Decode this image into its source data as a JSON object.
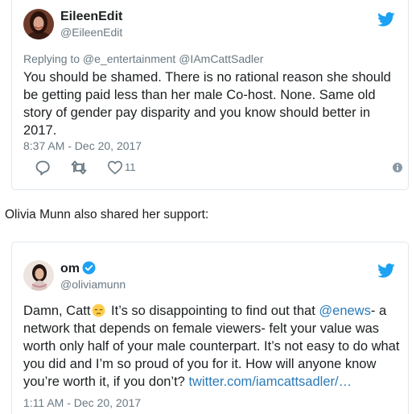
{
  "tweets": [
    {
      "display_name": "EileenEdit",
      "handle": "@EileenEdit",
      "reply_context": "Replying to @e_entertainment @IAmCattSadler",
      "body": "You should be shamed. There is no rational reason she should be getting paid less than her male Co-host. None. Same old story of gender pay disparity and you know should better in 2017.",
      "timestamp": "8:37 AM - Dec 20, 2017",
      "like_count": "11",
      "icons": [
        "twitter-bird-icon",
        "reply-icon",
        "retweet-icon",
        "heart-icon",
        "info-icon"
      ]
    },
    {
      "display_name": "om",
      "verified": true,
      "handle": "@oliviamunn",
      "body_before_emoji": "Damn, Catt",
      "body_after_emoji": " It’s so disappointing to find out that ",
      "mention": "@enews",
      "body_after_mention": "- a network that depends on female viewers- felt your value was worth only half of your male counterpart. It’s not easy to do what you did and I’m so proud of you for it. How will anyone know you’re worth it, if you don’t? ",
      "link": "twitter.com/iamcattsadler/…",
      "timestamp": "1:11 AM - Dec 20, 2017",
      "icons": [
        "twitter-bird-icon",
        "verified-badge-icon",
        "pensive-face-emoji"
      ]
    }
  ],
  "between_text": "Olivia Munn also shared her support:",
  "colors": {
    "twitter_blue": "#1da1f2",
    "secondary_text": "#697882",
    "link": "#2b7bb9",
    "card_border": "#e1e8ed"
  }
}
